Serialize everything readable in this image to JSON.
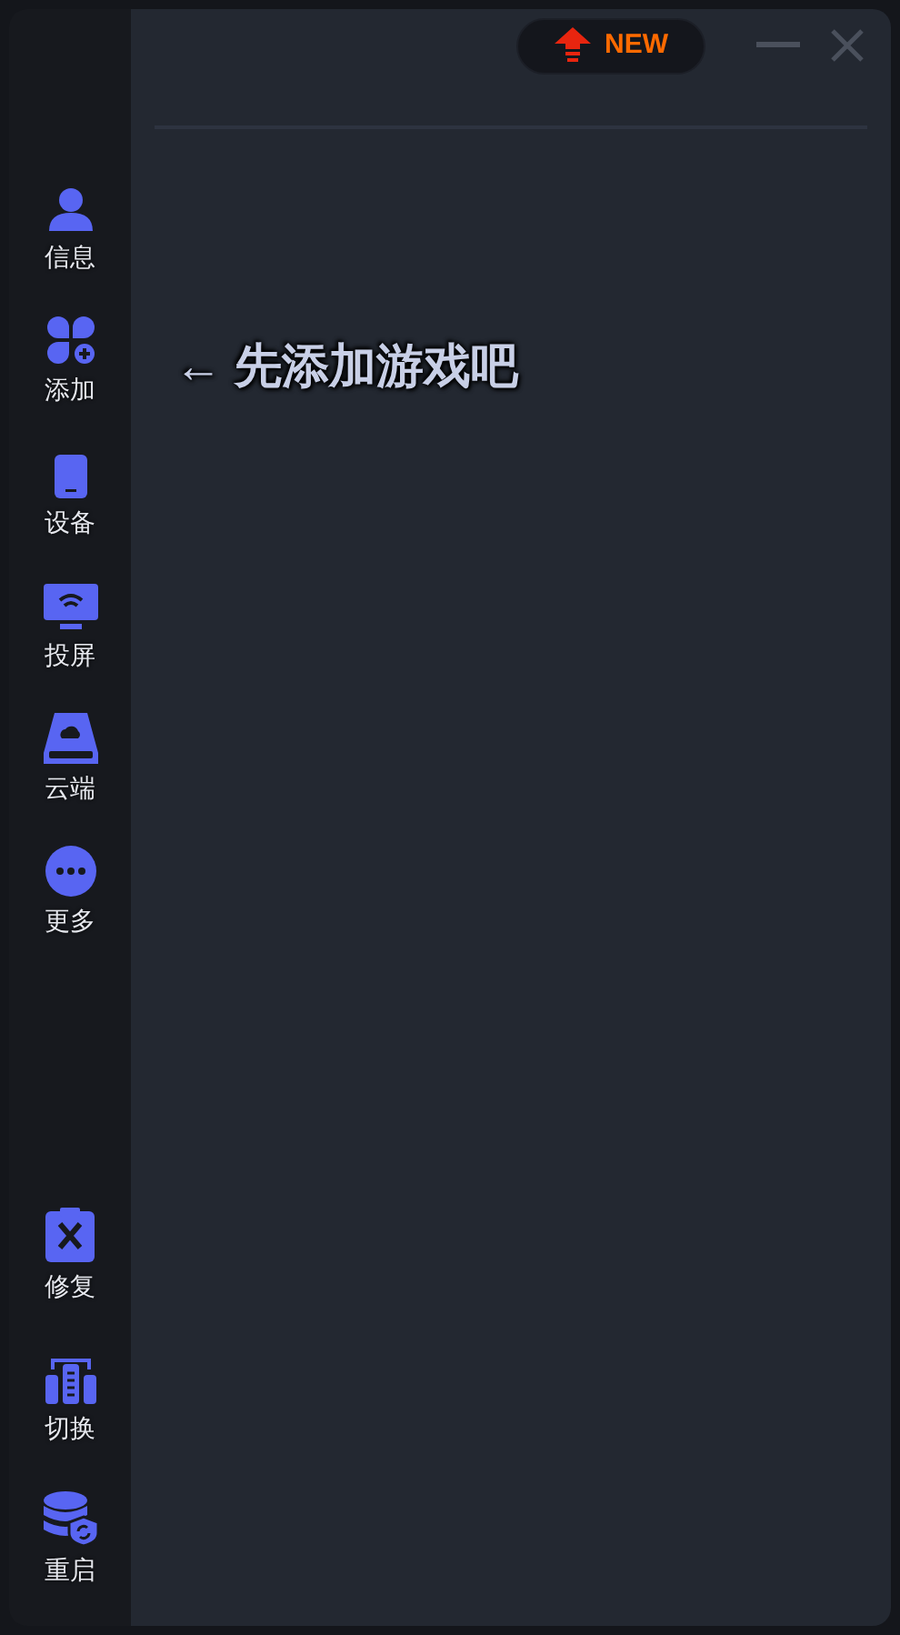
{
  "sidebar": {
    "top_items": [
      {
        "label": "信息"
      },
      {
        "label": "添加"
      },
      {
        "label": "设备"
      },
      {
        "label": "投屏"
      },
      {
        "label": "云端"
      },
      {
        "label": "更多"
      }
    ],
    "bottom_items": [
      {
        "label": "修复"
      },
      {
        "label": "切换"
      },
      {
        "label": "重启"
      }
    ]
  },
  "header": {
    "new_badge": "NEW"
  },
  "hint": "← 先添加游戏吧"
}
